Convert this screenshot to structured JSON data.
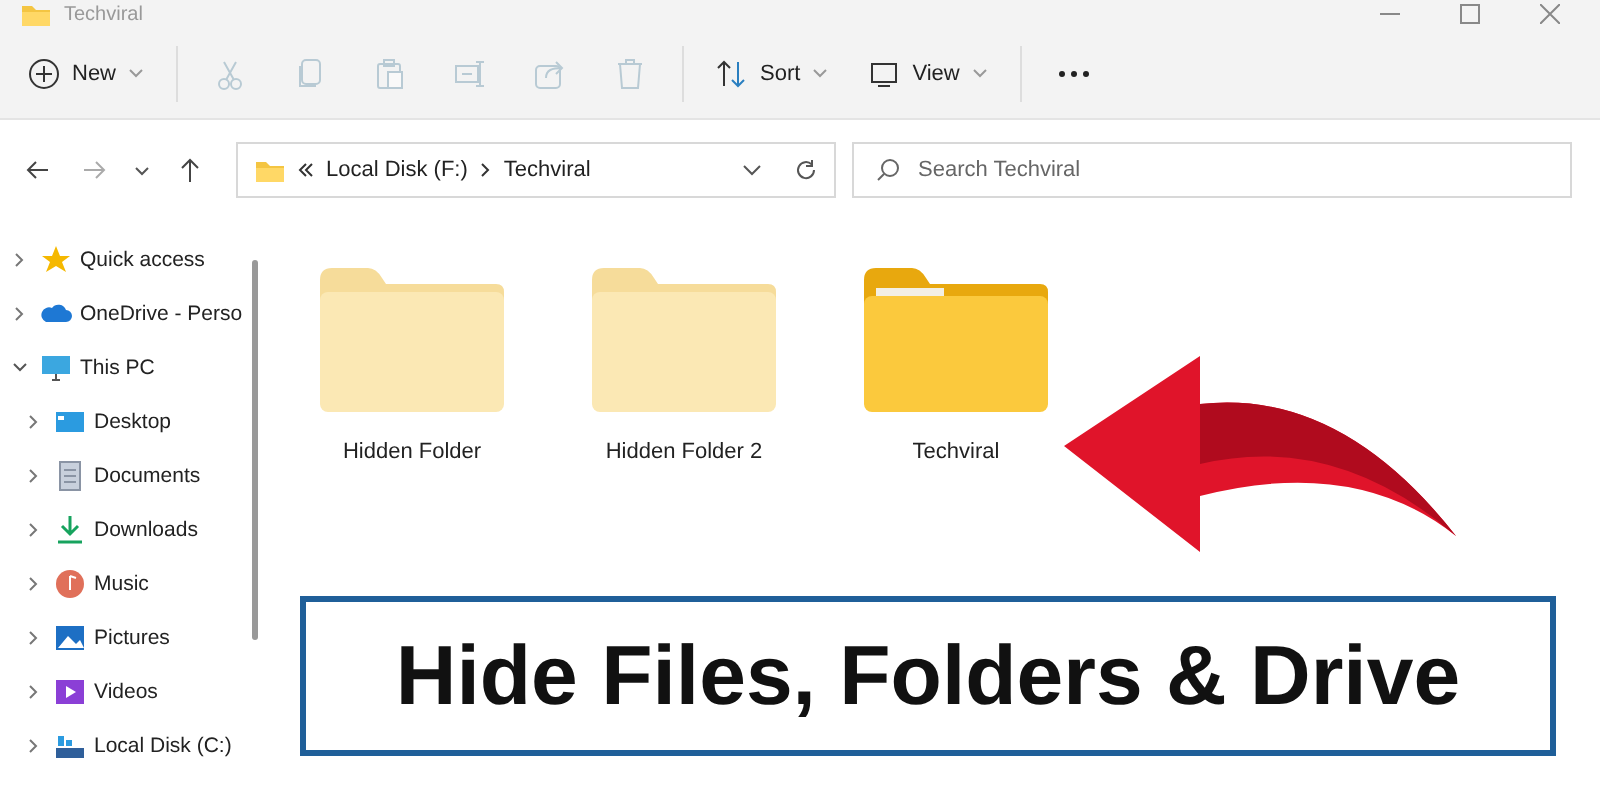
{
  "window": {
    "title": "Techviral"
  },
  "toolbar": {
    "new_label": "New",
    "sort_label": "Sort",
    "view_label": "View",
    "actions": [
      {
        "disabled": true
      },
      {
        "disabled": true
      },
      {
        "disabled": true
      },
      {
        "disabled": true
      },
      {
        "disabled": true
      },
      {
        "disabled": true
      }
    ]
  },
  "address_bar": {
    "path": [
      "Local Disk (F:)",
      "Techviral"
    ]
  },
  "search": {
    "placeholder": "Search Techviral"
  },
  "sidebar": {
    "items": [
      {
        "label": "Quick access",
        "expanded": false
      },
      {
        "label": "OneDrive - Perso",
        "expanded": false
      },
      {
        "label": "This PC",
        "expanded": true,
        "children": [
          {
            "label": "Desktop",
            "expanded": false
          },
          {
            "label": "Documents",
            "expanded": false
          },
          {
            "label": "Downloads",
            "expanded": false
          },
          {
            "label": "Music",
            "expanded": false
          },
          {
            "label": "Pictures",
            "expanded": false
          },
          {
            "label": "Videos",
            "expanded": false
          },
          {
            "label": "Local Disk (C:)",
            "expanded": false
          }
        ]
      }
    ]
  },
  "folders": [
    {
      "name": "Hidden Folder",
      "hidden": true
    },
    {
      "name": "Hidden Folder 2",
      "hidden": true
    },
    {
      "name": "Techviral",
      "hidden": false
    }
  ],
  "banner": {
    "text": "Hide Files, Folders & Drive"
  }
}
